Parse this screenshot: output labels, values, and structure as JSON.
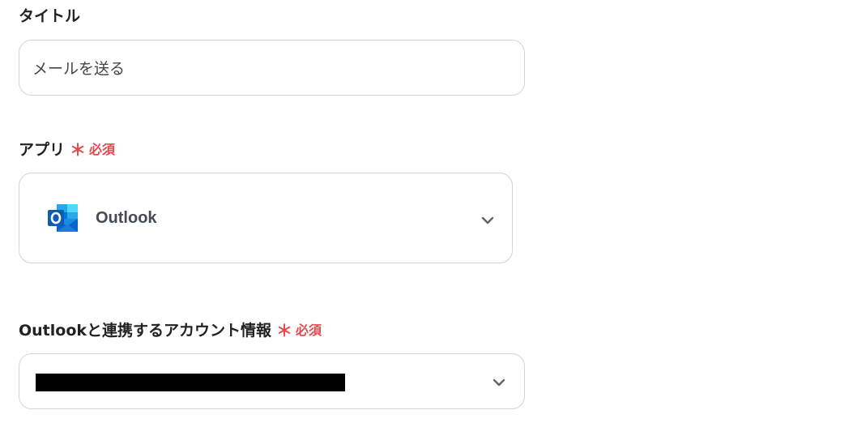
{
  "title_field": {
    "label": "タイトル",
    "value": "メールを送る"
  },
  "app_field": {
    "label": "アプリ",
    "required_mark": "＊",
    "required_text": "必須",
    "selected_app": "Outlook",
    "app_icon": "outlook-icon"
  },
  "account_field": {
    "label": "Outlookと連携するアカウント情報",
    "required_mark": "＊",
    "required_text": "必須",
    "value_redacted": true
  },
  "colors": {
    "required": "#e5484d",
    "border": "#d4d4d8",
    "outlook_blue": "#0a64c9"
  }
}
